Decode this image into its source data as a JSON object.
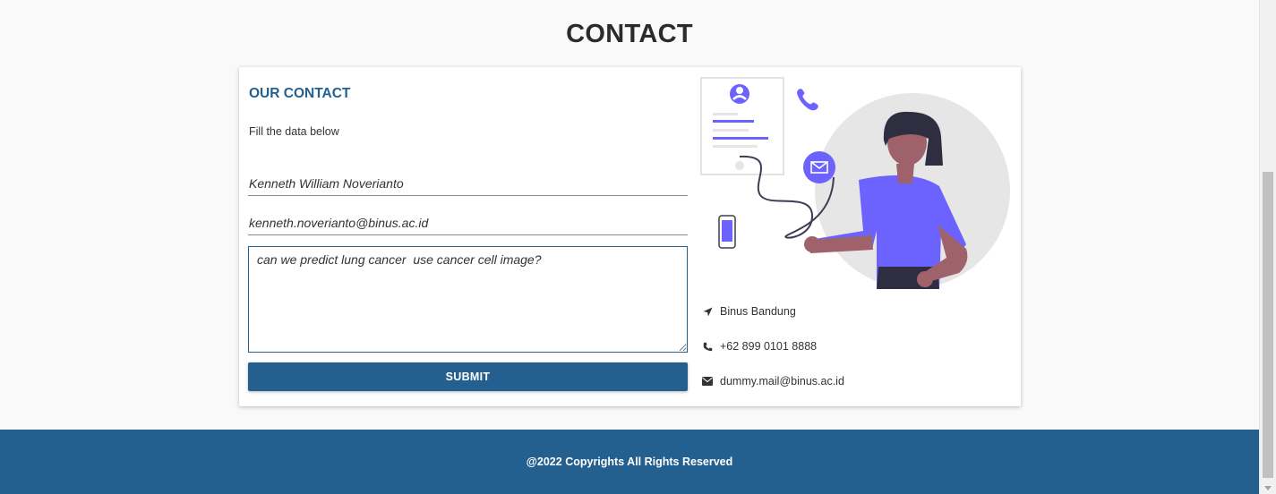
{
  "page": {
    "title": "CONTACT"
  },
  "form": {
    "heading": "OUR CONTACT",
    "subtitle": "Fill the data below",
    "name_value": "Kenneth William Noverianto",
    "email_value": "kenneth.noverianto@binus.ac.id",
    "message_value": "can we predict lung cancer  use cancer cell image?",
    "submit_label": "SUBMIT"
  },
  "contact_info": {
    "address": "Binus Bandung",
    "phone": "+62 899 0101 8888",
    "email": "dummy.mail@binus.ac.id",
    "icons": {
      "address": "location-arrow-icon",
      "phone": "phone-icon",
      "email": "envelope-icon"
    }
  },
  "footer": {
    "text": "@2022 Copyrights All Rights Reserved"
  },
  "colors": {
    "brand": "#235f8f",
    "accent": "#6c63ff",
    "background": "#f9f9f9"
  }
}
